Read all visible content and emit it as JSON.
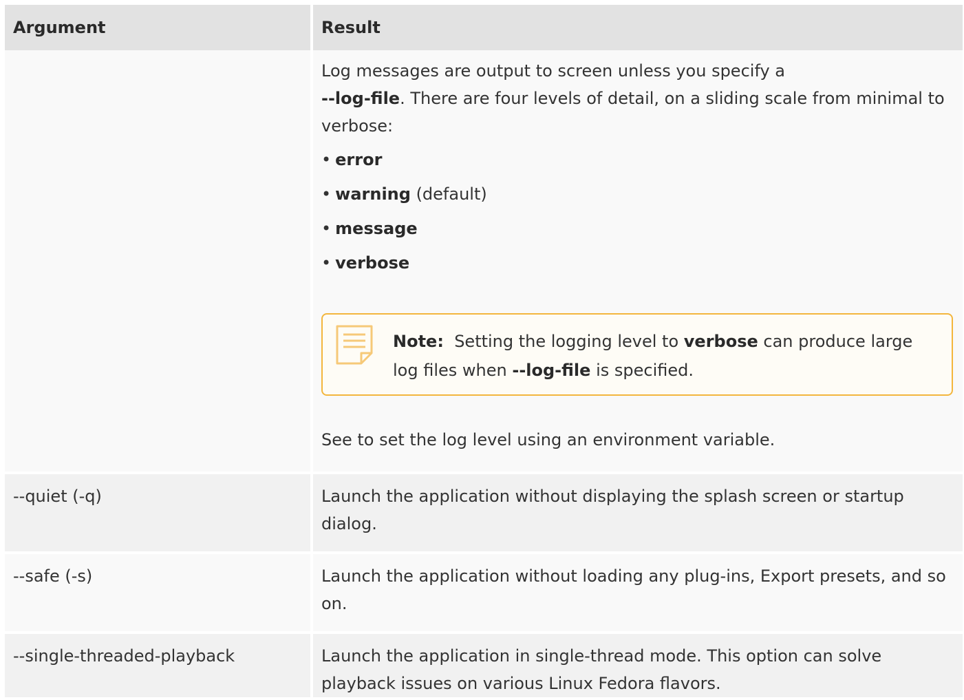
{
  "table": {
    "headers": {
      "argument": "Argument",
      "result": "Result"
    },
    "row1": {
      "argument": "",
      "intro_1": "Log messages are output to screen unless you specify a",
      "intro_flag": "--log-file",
      "intro_2": ". There are four levels of detail, on a sliding scale from minimal to verbose:",
      "bullet_symbol": "•",
      "levels": [
        {
          "name": "error",
          "suffix": ""
        },
        {
          "name": "warning",
          "suffix": " (default)"
        },
        {
          "name": "message",
          "suffix": ""
        },
        {
          "name": "verbose",
          "suffix": ""
        }
      ],
      "note": {
        "label": "Note:",
        "text_1": "Setting the logging level to",
        "bold_1": "verbose",
        "text_2": "can produce large log files when",
        "bold_2": "--log-file",
        "text_3": "is specified.",
        "icon": "note-icon",
        "border_color": "#f3b63d"
      },
      "see_text": "See to set the log level using an environment variable."
    },
    "rows": [
      {
        "argument": "--quiet (-q)",
        "result": "Launch the application without displaying the splash screen or startup dialog."
      },
      {
        "argument": "--safe (-s)",
        "result": "Launch the application without loading any plug-ins, Export presets, and so on."
      },
      {
        "argument": "--single-threaded-playback",
        "result": "Launch the application in single-thread mode. This option can solve playback issues on various Linux Fedora flavors."
      }
    ]
  }
}
